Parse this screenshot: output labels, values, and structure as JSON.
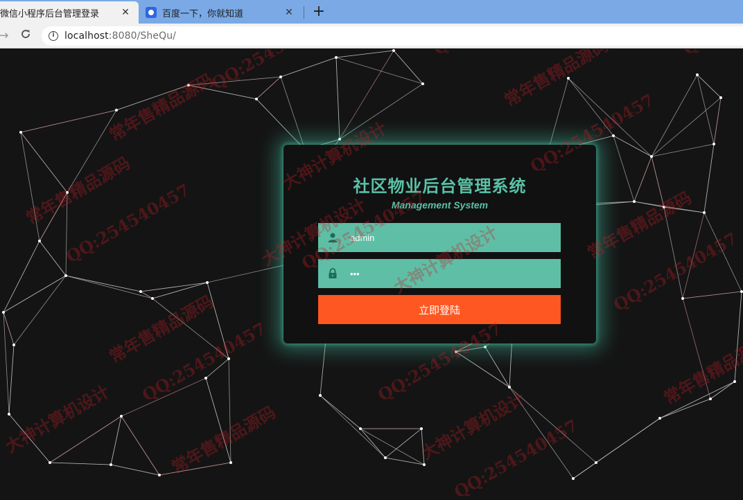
{
  "browser": {
    "tabs": [
      {
        "title": "微信小程序后台管理登录",
        "active": true
      },
      {
        "title": "百度一下，你就知道",
        "active": false
      }
    ],
    "new_tab_symbol": "+",
    "close_symbol": "✕",
    "url_host": "localhost",
    "url_rest": ":8080/SheQu/"
  },
  "login": {
    "title": "社区物业后台管理系统",
    "subtitle": "Management System",
    "username_value": "admin",
    "password_value": "•••",
    "submit_label": "立即登陆"
  },
  "theme": {
    "accent": "#5ebfa6",
    "button": "#ff5722",
    "background": "#141414"
  },
  "icons": [
    "user-icon",
    "lock-icon",
    "info-icon",
    "back-icon",
    "reload-icon",
    "baidu-icon"
  ],
  "watermarks": [
    "QQ:254540457",
    "常年售精品源码",
    "大神计算机设计"
  ]
}
